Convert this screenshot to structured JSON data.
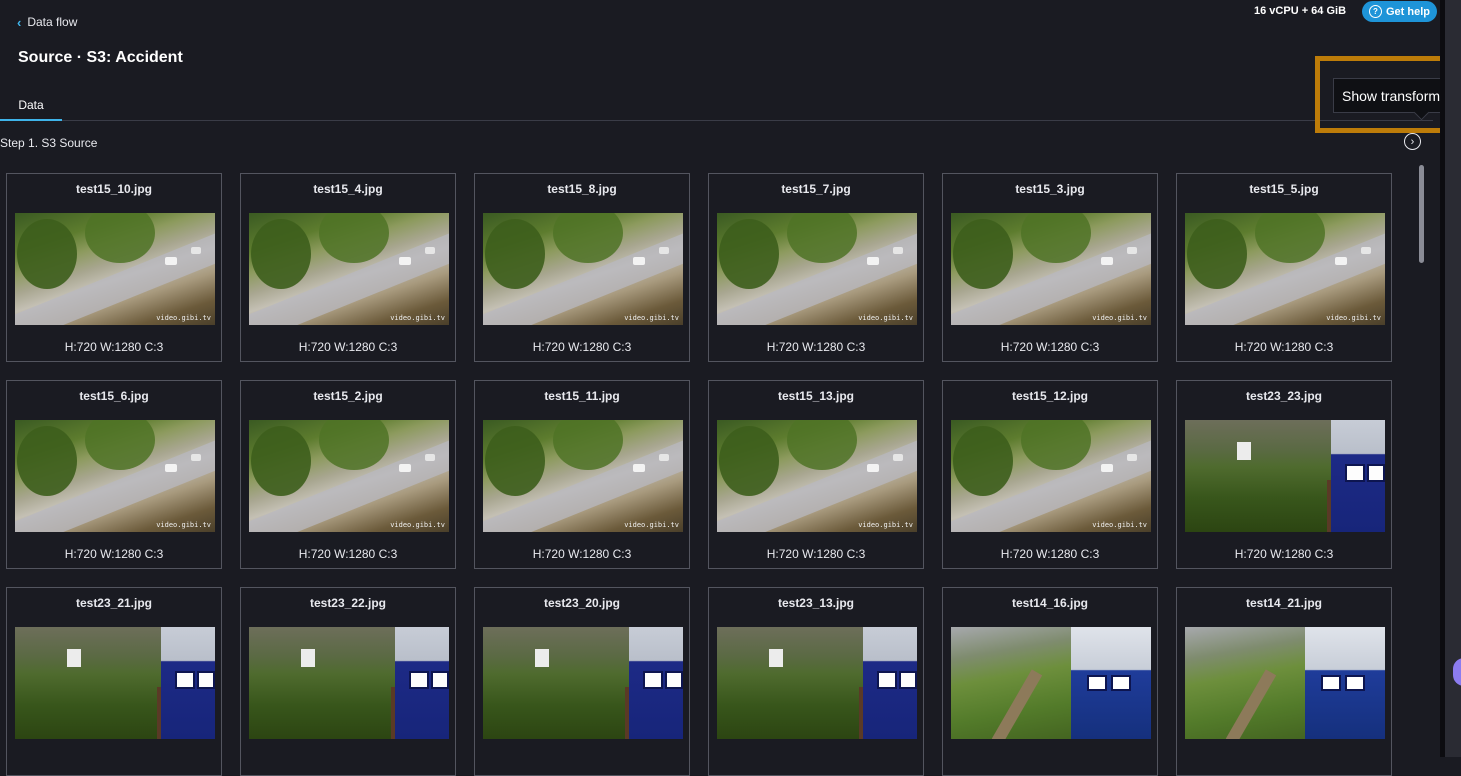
{
  "header": {
    "back_label": "Data flow",
    "title": "Source · S3: Accident",
    "resources": "16 vCPU + 64 GiB",
    "help_label": "Get help"
  },
  "tabs": [
    {
      "label": "Data"
    }
  ],
  "step": {
    "label": "Step 1. S3 Source"
  },
  "tooltip": {
    "label": "Show transforms"
  },
  "images": [
    {
      "name": "test15_10.jpg",
      "meta": "H:720 W:1280 C:3",
      "scene": "a"
    },
    {
      "name": "test15_4.jpg",
      "meta": "H:720 W:1280 C:3",
      "scene": "a"
    },
    {
      "name": "test15_8.jpg",
      "meta": "H:720 W:1280 C:3",
      "scene": "a"
    },
    {
      "name": "test15_7.jpg",
      "meta": "H:720 W:1280 C:3",
      "scene": "a"
    },
    {
      "name": "test15_3.jpg",
      "meta": "H:720 W:1280 C:3",
      "scene": "a"
    },
    {
      "name": "test15_5.jpg",
      "meta": "H:720 W:1280 C:3",
      "scene": "a"
    },
    {
      "name": "test15_6.jpg",
      "meta": "H:720 W:1280 C:3",
      "scene": "a"
    },
    {
      "name": "test15_2.jpg",
      "meta": "H:720 W:1280 C:3",
      "scene": "a"
    },
    {
      "name": "test15_11.jpg",
      "meta": "H:720 W:1280 C:3",
      "scene": "a"
    },
    {
      "name": "test15_13.jpg",
      "meta": "H:720 W:1280 C:3",
      "scene": "a"
    },
    {
      "name": "test15_12.jpg",
      "meta": "H:720 W:1280 C:3",
      "scene": "a"
    },
    {
      "name": "test23_23.jpg",
      "meta": "H:720 W:1280 C:3",
      "scene": "b"
    },
    {
      "name": "test23_21.jpg",
      "meta": "",
      "scene": "b"
    },
    {
      "name": "test23_22.jpg",
      "meta": "",
      "scene": "b"
    },
    {
      "name": "test23_20.jpg",
      "meta": "",
      "scene": "b"
    },
    {
      "name": "test23_13.jpg",
      "meta": "",
      "scene": "b"
    },
    {
      "name": "test14_16.jpg",
      "meta": "",
      "scene": "c"
    },
    {
      "name": "test14_21.jpg",
      "meta": "",
      "scene": "c"
    }
  ],
  "watermark": "video.gibi.tv",
  "colors": {
    "accent": "#3fb4ea",
    "help_button": "#1e94d8",
    "highlight": "#bd7c09"
  }
}
